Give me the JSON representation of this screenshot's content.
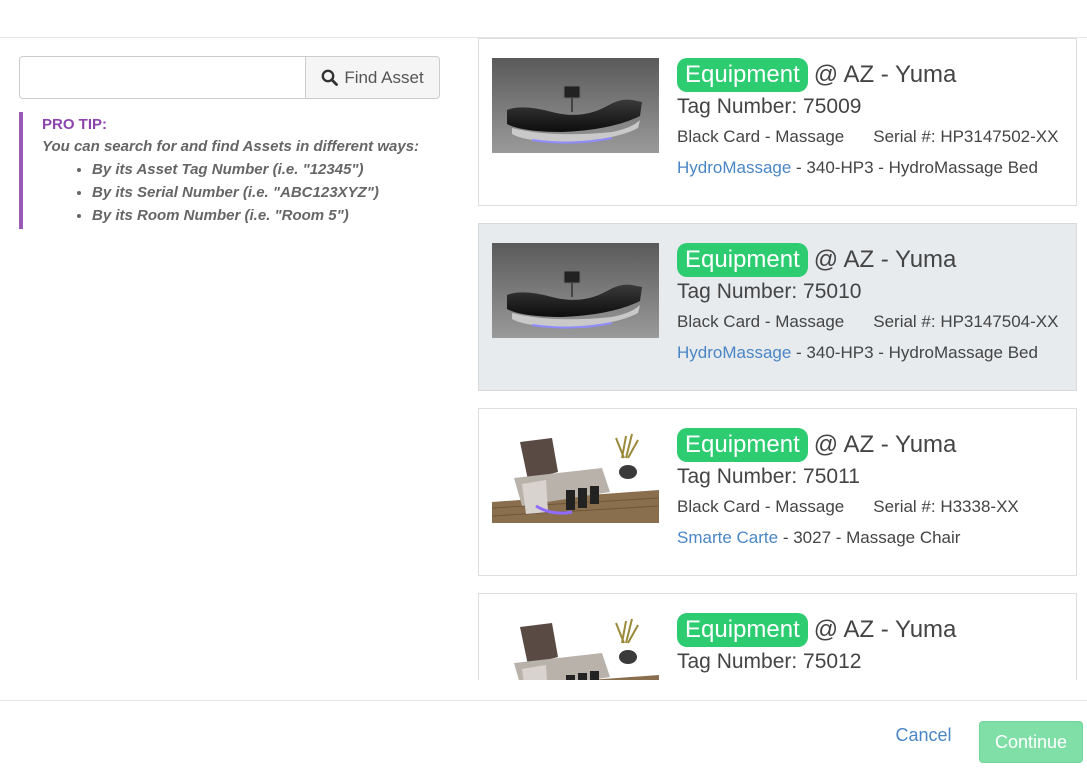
{
  "search": {
    "value": "",
    "placeholder": "",
    "button_label": "Find Asset",
    "button_icon": "search-icon"
  },
  "pro_tip": {
    "title": "PRO TIP:",
    "intro": "You can search for and find Assets in different ways:",
    "items": [
      "By its Asset Tag Number (i.e. \"12345\")",
      "By its Serial Number (i.e. \"ABC123XYZ\")",
      "By its Room Number (i.e. \"Room 5\")"
    ]
  },
  "results": [
    {
      "badge": "Equipment",
      "location": "@ AZ - Yuma",
      "tag": "Tag Number: 75009",
      "category": "Black Card - Massage",
      "serial": "Serial #: HP3147502-XX",
      "brand": "HydroMassage",
      "model": " - 340-HP3 - HydroMassage Bed",
      "image": "hydromassage-bed-image"
    },
    {
      "badge": "Equipment",
      "location": "@ AZ - Yuma",
      "tag": "Tag Number: 75010",
      "category": "Black Card - Massage",
      "serial": "Serial #: HP3147504-XX",
      "brand": "HydroMassage",
      "model": " - 340-HP3 - HydroMassage Bed",
      "image": "hydromassage-bed-image"
    },
    {
      "badge": "Equipment",
      "location": "@ AZ - Yuma",
      "tag": "Tag Number: 75011",
      "category": "Black Card - Massage",
      "serial": "Serial #: H3338-XX",
      "brand": "Smarte Carte",
      "model": " - 3027 - Massage Chair",
      "image": "massage-chair-image"
    },
    {
      "badge": "Equipment",
      "location": "@ AZ - Yuma",
      "tag": "Tag Number: 75012",
      "category": "",
      "serial": "",
      "brand": "",
      "model": "",
      "image": "massage-chair-image"
    }
  ],
  "footer": {
    "cancel_label": "Cancel",
    "continue_label": "Continue"
  },
  "colors": {
    "badge": "#2ecc71",
    "link": "#4a86c5",
    "pro_tip_accent": "#9b59b6",
    "continue_button": "#7fdfa6",
    "selected_card": "#e8ebee"
  }
}
